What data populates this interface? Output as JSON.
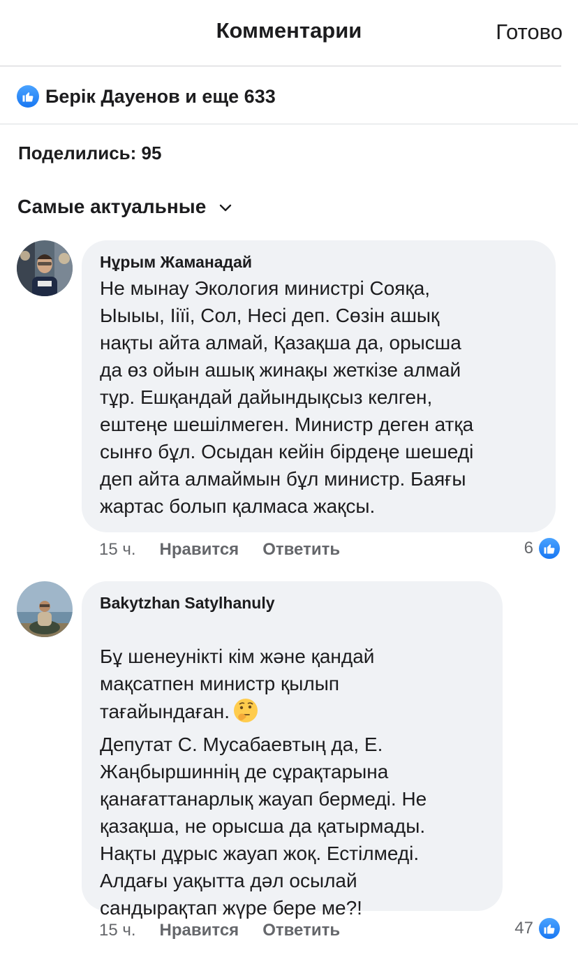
{
  "header": {
    "title": "Комментарии",
    "done_label": "Готово"
  },
  "reactions": {
    "text": "Берік Дауенов и еще 633",
    "icon": "like-icon",
    "color": "#1877f2"
  },
  "shares": {
    "text": "Поделились: 95"
  },
  "sort": {
    "label": "Самые актуальные"
  },
  "comments": [
    {
      "author": "Нұрым Жаманадай",
      "text": "Не мынау Экология министрі Сояқа,\nЫыыы, Ііїі, Сол, Несі деп. Сөзін ашық\nнақты айта алмай, Қазақша да, орысша\nда өз ойын ашық жинақы жеткізе алмай\nтұр. Ешқандай дайындықсыз келген,\nештеңе шешілмеген. Министр деген атқа\nсынғо бұл. Осыдан кейін бірдеңе шешеді\nдеп айта алмаймын бұл министр. Баяғы\nжартас болып қалмаса жақсы.",
      "time": "15 ч.",
      "like_label": "Нравится",
      "reply_label": "Ответить",
      "likes": "6"
    },
    {
      "author": "Bakytzhan Satylhanuly",
      "text_part1": "Бұ  шенеунікті  кім және қандай\nмақсатпен  министр қылып\nтағайындаған.",
      "emoji": "thinking-face-icon",
      "text_part2": "Депутат  С. Мусабаевтың да, Е.\nЖаңбыршиннің де сұрақтарына\nқанағаттанарлық жауап бермеді. Не\nқазақша, не орысша да қатырмады.\nНақты  дұрыс жауап жоқ. Естілмеді.\nАлдағы уақытта дәл  осылай\nсандырақтап жүре бере ме?!",
      "time": "15 ч.",
      "like_label": "Нравится",
      "reply_label": "Ответить",
      "likes": "47"
    }
  ]
}
